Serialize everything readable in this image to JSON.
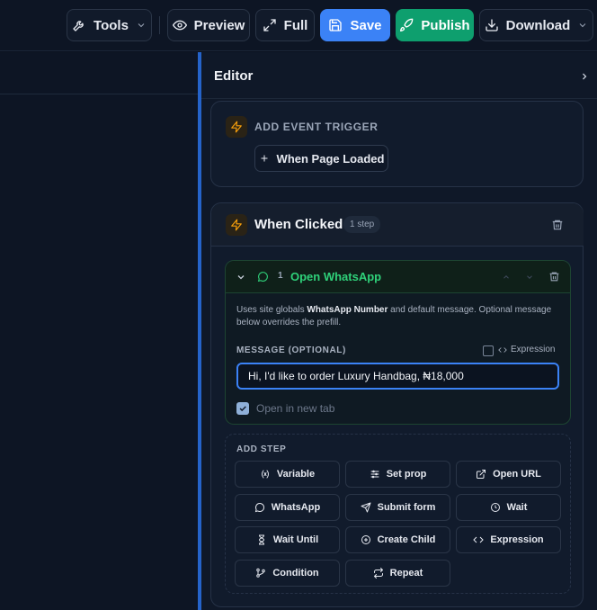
{
  "toolbar": {
    "tools_label": "Tools",
    "preview_label": "Preview",
    "full_label": "Full",
    "save_label": "Save",
    "publish_label": "Publish",
    "download_label": "Download"
  },
  "editor": {
    "title": "Editor",
    "add_trigger": {
      "label": "ADD EVENT TRIGGER",
      "button_label": "When Page Loaded"
    },
    "trigger": {
      "title": "When Clicked",
      "badge": "1 step"
    },
    "step": {
      "number": "1",
      "name": "Open WhatsApp",
      "description_prefix": "Uses site globals ",
      "description_bold": "WhatsApp Number",
      "description_suffix": " and default message. Optional message below overrides the prefill.",
      "message_label": "MESSAGE (OPTIONAL)",
      "expression_label": "Expression",
      "message_value": "Hi, I'd like to order Luxury Handbag, ₦18,000",
      "open_new_tab_label": "Open in new tab"
    },
    "add_step": {
      "label": "ADD STEP",
      "buttons": [
        "Variable",
        "Set prop",
        "Open URL",
        "WhatsApp",
        "Submit form",
        "Wait",
        "Wait Until",
        "Create Child",
        "Expression",
        "Condition",
        "Repeat"
      ]
    }
  },
  "colors": {
    "save": "#3b82f6",
    "publish": "#0e9f6e",
    "accent_split": "#2563c9",
    "step_green": "#2fd27a",
    "bolt": "#f59e0b"
  }
}
